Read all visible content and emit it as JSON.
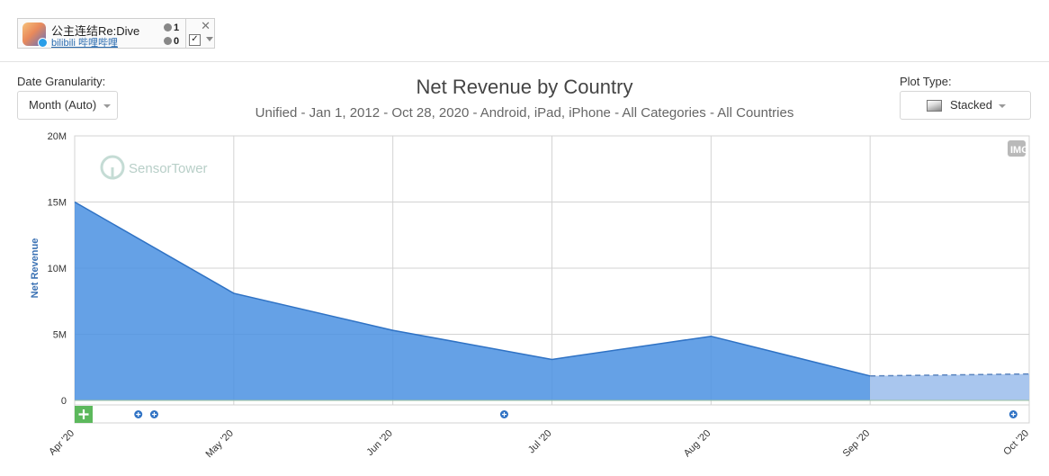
{
  "app": {
    "name": "公主连结Re:Dive",
    "publisher": "bilibili 哔哩哔哩",
    "ios_count": "1",
    "android_count": "0",
    "close_glyph": "✕",
    "check_glyph": "✓"
  },
  "controls": {
    "granularity_label": "Date Granularity:",
    "granularity_value": "Month (Auto)",
    "plot_type_label": "Plot Type:",
    "plot_type_value": "Stacked"
  },
  "watermark": "SensorTower",
  "corner_badge": "IMG",
  "colors": {
    "series": "#4a90e2",
    "projected": "#a9c6ee",
    "grid": "#d3d3d3",
    "add_button": "#5cb85c",
    "marker": "#2f72c4"
  },
  "chart_data": {
    "type": "area",
    "title": "Net Revenue by Country",
    "subtitle": "Unified - Jan 1, 2012 - Oct 28, 2020 - Android, iPad, iPhone - All Categories - All Countries",
    "ylabel": "Net Revenue",
    "xlabel": "",
    "stacked": true,
    "ylim": [
      0,
      20000000
    ],
    "yticks": [
      {
        "value": 0,
        "label": "0"
      },
      {
        "value": 5000000,
        "label": "5M"
      },
      {
        "value": 10000000,
        "label": "10M"
      },
      {
        "value": 15000000,
        "label": "15M"
      },
      {
        "value": 20000000,
        "label": "20M"
      }
    ],
    "categories": [
      "Apr '20",
      "May '20",
      "Jun '20",
      "Jul '20",
      "Aug '20",
      "Sep '20",
      "Oct '20"
    ],
    "series": [
      {
        "values": [
          15000000,
          8100000,
          5300000,
          3100000,
          4850000,
          1850000,
          2000000
        ],
        "projected_from_index": 5
      }
    ],
    "event_markers": [
      "Apr '20 +0.4",
      "Apr '20 +0.5",
      "Jun '20 +0.7",
      "Oct '20 -0.1"
    ],
    "grid": true,
    "legend": "none"
  }
}
